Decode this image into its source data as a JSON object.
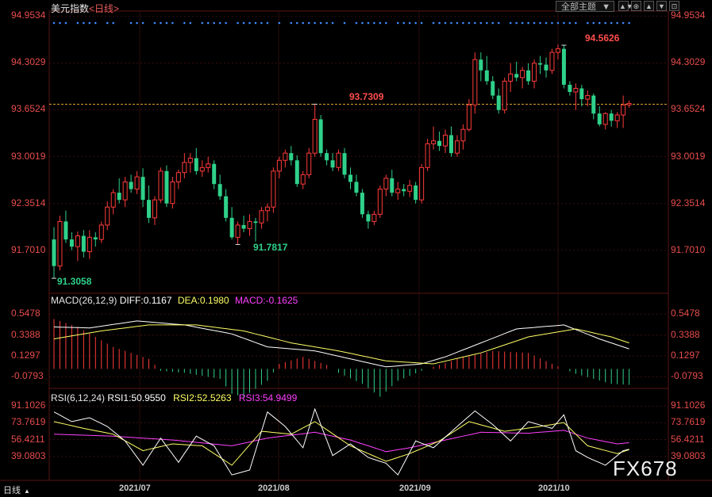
{
  "header": {
    "title": "美元指数",
    "period_tag": "<日线>",
    "theme_label": "全部主题",
    "theme_arrow": "▼",
    "tool_icons": [
      "▲▼",
      "⊕",
      "▲",
      "▼",
      "⊡"
    ]
  },
  "colors": {
    "up": "#ff3b3b",
    "down": "#2fd18a",
    "axis_text": "#e84c4c",
    "grid": "#3a0e0e",
    "ref_line": "#d9a030",
    "diff": "#ffffff",
    "dea": "#ffff66",
    "macd_label": "#ff40ff",
    "rsi3": "#ff40ff",
    "dots": "#3d8bfd"
  },
  "footer": {
    "period_label": "日线",
    "watermark": "FX678"
  },
  "chart_data": [
    {
      "type": "candlestick",
      "title": "美元指数<日线>",
      "ylim": [
        91.3,
        94.98
      ],
      "y_ticks": [
        "94.9534",
        "94.3029",
        "93.6524",
        "93.0019",
        "92.3514",
        "91.7010"
      ],
      "x_ticks": [
        "2021/07",
        "2021/08",
        "2021/09",
        "2021/10"
      ],
      "reference_line": 93.73,
      "annotations": [
        {
          "text": "94.5626",
          "type": "high",
          "index": 86
        },
        {
          "text": "93.7309",
          "type": "high",
          "index": 44
        },
        {
          "text": "91.7817",
          "type": "low",
          "index": 31
        },
        {
          "text": "91.3058",
          "type": "low",
          "index": 0
        }
      ],
      "marker_dots": "daily event markers row above the price series",
      "candles": [
        {
          "o": 91.85,
          "h": 92.02,
          "l": 91.31,
          "c": 91.48
        },
        {
          "o": 91.48,
          "h": 92.18,
          "l": 91.42,
          "c": 92.1
        },
        {
          "o": 92.1,
          "h": 92.25,
          "l": 91.8,
          "c": 91.85
        },
        {
          "o": 91.85,
          "h": 91.95,
          "l": 91.7,
          "c": 91.75
        },
        {
          "o": 91.75,
          "h": 91.96,
          "l": 91.55,
          "c": 91.9
        },
        {
          "o": 91.9,
          "h": 91.98,
          "l": 91.6,
          "c": 91.68
        },
        {
          "o": 91.68,
          "h": 91.98,
          "l": 91.58,
          "c": 91.88
        },
        {
          "o": 91.88,
          "h": 91.95,
          "l": 91.75,
          "c": 91.85
        },
        {
          "o": 91.85,
          "h": 92.1,
          "l": 91.8,
          "c": 92.05
        },
        {
          "o": 92.05,
          "h": 92.38,
          "l": 91.98,
          "c": 92.3
        },
        {
          "o": 92.3,
          "h": 92.55,
          "l": 92.2,
          "c": 92.5
        },
        {
          "o": 92.5,
          "h": 92.7,
          "l": 92.35,
          "c": 92.4
        },
        {
          "o": 92.4,
          "h": 92.72,
          "l": 92.3,
          "c": 92.65
        },
        {
          "o": 92.65,
          "h": 92.75,
          "l": 92.5,
          "c": 92.55
        },
        {
          "o": 92.55,
          "h": 92.8,
          "l": 92.48,
          "c": 92.72
        },
        {
          "o": 92.72,
          "h": 92.84,
          "l": 92.3,
          "c": 92.4
        },
        {
          "o": 92.4,
          "h": 92.6,
          "l": 92.08,
          "c": 92.15
        },
        {
          "o": 92.15,
          "h": 92.45,
          "l": 92.05,
          "c": 92.4
        },
        {
          "o": 92.4,
          "h": 92.85,
          "l": 92.36,
          "c": 92.8
        },
        {
          "o": 92.8,
          "h": 92.88,
          "l": 92.3,
          "c": 92.35
        },
        {
          "o": 92.35,
          "h": 92.72,
          "l": 92.28,
          "c": 92.65
        },
        {
          "o": 92.65,
          "h": 92.82,
          "l": 92.55,
          "c": 92.78
        },
        {
          "o": 92.78,
          "h": 93.05,
          "l": 92.7,
          "c": 92.92
        },
        {
          "o": 92.92,
          "h": 93.05,
          "l": 92.78,
          "c": 92.98
        },
        {
          "o": 92.98,
          "h": 93.12,
          "l": 92.75,
          "c": 92.8
        },
        {
          "o": 92.8,
          "h": 92.95,
          "l": 92.72,
          "c": 92.85
        },
        {
          "o": 92.85,
          "h": 93.0,
          "l": 92.78,
          "c": 92.9
        },
        {
          "o": 92.9,
          "h": 92.95,
          "l": 92.55,
          "c": 92.62
        },
        {
          "o": 92.62,
          "h": 92.75,
          "l": 92.4,
          "c": 92.45
        },
        {
          "o": 92.45,
          "h": 92.55,
          "l": 92.1,
          "c": 92.15
        },
        {
          "o": 92.15,
          "h": 92.3,
          "l": 91.85,
          "c": 91.88
        },
        {
          "o": 91.88,
          "h": 92.1,
          "l": 91.78,
          "c": 92.05
        },
        {
          "o": 92.05,
          "h": 92.18,
          "l": 91.95,
          "c": 92.0
        },
        {
          "o": 92.0,
          "h": 92.2,
          "l": 91.9,
          "c": 92.1
        },
        {
          "o": 92.1,
          "h": 92.15,
          "l": 91.82,
          "c": 92.08
        },
        {
          "o": 92.08,
          "h": 92.3,
          "l": 92.0,
          "c": 92.25
        },
        {
          "o": 92.25,
          "h": 92.35,
          "l": 92.1,
          "c": 92.3
        },
        {
          "o": 92.3,
          "h": 92.85,
          "l": 92.22,
          "c": 92.8
        },
        {
          "o": 92.8,
          "h": 93.0,
          "l": 92.7,
          "c": 92.95
        },
        {
          "o": 92.95,
          "h": 93.1,
          "l": 92.85,
          "c": 93.05
        },
        {
          "o": 93.05,
          "h": 93.15,
          "l": 92.88,
          "c": 92.95
        },
        {
          "o": 92.95,
          "h": 93.02,
          "l": 92.58,
          "c": 92.62
        },
        {
          "o": 92.62,
          "h": 92.8,
          "l": 92.55,
          "c": 92.75
        },
        {
          "o": 92.75,
          "h": 93.12,
          "l": 92.7,
          "c": 93.05
        },
        {
          "o": 93.05,
          "h": 93.73,
          "l": 93.0,
          "c": 93.52
        },
        {
          "o": 93.52,
          "h": 93.58,
          "l": 93.0,
          "c": 93.05
        },
        {
          "o": 93.05,
          "h": 93.1,
          "l": 92.88,
          "c": 92.95
        },
        {
          "o": 92.95,
          "h": 93.05,
          "l": 92.8,
          "c": 92.85
        },
        {
          "o": 92.85,
          "h": 93.1,
          "l": 92.8,
          "c": 93.05
        },
        {
          "o": 93.05,
          "h": 93.12,
          "l": 92.7,
          "c": 92.75
        },
        {
          "o": 92.75,
          "h": 92.85,
          "l": 92.55,
          "c": 92.65
        },
        {
          "o": 92.65,
          "h": 92.75,
          "l": 92.45,
          "c": 92.5
        },
        {
          "o": 92.5,
          "h": 92.55,
          "l": 92.15,
          "c": 92.2
        },
        {
          "o": 92.2,
          "h": 92.25,
          "l": 92.0,
          "c": 92.1
        },
        {
          "o": 92.1,
          "h": 92.25,
          "l": 92.05,
          "c": 92.2
        },
        {
          "o": 92.2,
          "h": 92.6,
          "l": 92.15,
          "c": 92.55
        },
        {
          "o": 92.55,
          "h": 92.75,
          "l": 92.45,
          "c": 92.7
        },
        {
          "o": 92.7,
          "h": 92.82,
          "l": 92.45,
          "c": 92.5
        },
        {
          "o": 92.5,
          "h": 92.65,
          "l": 92.4,
          "c": 92.55
        },
        {
          "o": 92.55,
          "h": 92.62,
          "l": 92.45,
          "c": 92.52
        },
        {
          "o": 92.52,
          "h": 92.68,
          "l": 92.44,
          "c": 92.6
        },
        {
          "o": 92.6,
          "h": 92.65,
          "l": 92.35,
          "c": 92.4
        },
        {
          "o": 92.4,
          "h": 92.9,
          "l": 92.35,
          "c": 92.85
        },
        {
          "o": 92.85,
          "h": 93.25,
          "l": 92.8,
          "c": 93.18
        },
        {
          "o": 93.18,
          "h": 93.42,
          "l": 93.1,
          "c": 93.22
        },
        {
          "o": 93.22,
          "h": 93.35,
          "l": 93.08,
          "c": 93.15
        },
        {
          "o": 93.15,
          "h": 93.38,
          "l": 93.05,
          "c": 93.3
        },
        {
          "o": 93.3,
          "h": 93.42,
          "l": 93.0,
          "c": 93.05
        },
        {
          "o": 93.05,
          "h": 93.3,
          "l": 93.0,
          "c": 93.22
        },
        {
          "o": 93.22,
          "h": 93.45,
          "l": 93.1,
          "c": 93.38
        },
        {
          "o": 93.38,
          "h": 93.8,
          "l": 93.35,
          "c": 93.72
        },
        {
          "o": 93.72,
          "h": 94.45,
          "l": 93.6,
          "c": 94.35
        },
        {
          "o": 94.35,
          "h": 94.45,
          "l": 94.05,
          "c": 94.2
        },
        {
          "o": 94.2,
          "h": 94.4,
          "l": 94.0,
          "c": 94.05
        },
        {
          "o": 94.05,
          "h": 94.12,
          "l": 93.8,
          "c": 93.85
        },
        {
          "o": 93.85,
          "h": 93.95,
          "l": 93.6,
          "c": 93.65
        },
        {
          "o": 93.65,
          "h": 94.1,
          "l": 93.6,
          "c": 94.05
        },
        {
          "o": 94.05,
          "h": 94.3,
          "l": 93.9,
          "c": 94.15
        },
        {
          "o": 94.15,
          "h": 94.32,
          "l": 94.05,
          "c": 94.1
        },
        {
          "o": 94.1,
          "h": 94.25,
          "l": 93.95,
          "c": 94.2
        },
        {
          "o": 94.2,
          "h": 94.3,
          "l": 94.0,
          "c": 94.05
        },
        {
          "o": 94.05,
          "h": 94.35,
          "l": 93.95,
          "c": 94.3
        },
        {
          "o": 94.3,
          "h": 94.4,
          "l": 94.15,
          "c": 94.28
        },
        {
          "o": 94.28,
          "h": 94.38,
          "l": 94.1,
          "c": 94.2
        },
        {
          "o": 94.2,
          "h": 94.5,
          "l": 94.15,
          "c": 94.45
        },
        {
          "o": 94.45,
          "h": 94.56,
          "l": 94.35,
          "c": 94.5
        },
        {
          "o": 94.5,
          "h": 94.55,
          "l": 93.95,
          "c": 94.0
        },
        {
          "o": 94.0,
          "h": 94.05,
          "l": 93.85,
          "c": 93.9
        },
        {
          "o": 93.9,
          "h": 94.02,
          "l": 93.65,
          "c": 93.95
        },
        {
          "o": 93.95,
          "h": 94.0,
          "l": 93.7,
          "c": 93.8
        },
        {
          "o": 93.8,
          "h": 93.92,
          "l": 93.7,
          "c": 93.85
        },
        {
          "o": 93.85,
          "h": 93.88,
          "l": 93.52,
          "c": 93.6
        },
        {
          "o": 93.6,
          "h": 93.7,
          "l": 93.42,
          "c": 93.45
        },
        {
          "o": 93.45,
          "h": 93.62,
          "l": 93.38,
          "c": 93.6
        },
        {
          "o": 93.6,
          "h": 93.65,
          "l": 93.42,
          "c": 93.5
        },
        {
          "o": 93.5,
          "h": 93.62,
          "l": 93.4,
          "c": 93.58
        },
        {
          "o": 93.58,
          "h": 93.85,
          "l": 93.4,
          "c": 93.72
        },
        {
          "o": 93.72,
          "h": 93.78,
          "l": 93.68,
          "c": 93.74
        }
      ]
    },
    {
      "type": "bar+line",
      "title": "MACD(26,12,9)",
      "legend": [
        {
          "label": "DIFF:0.1167",
          "color": "#ffffff"
        },
        {
          "label": "DEA:0.1980",
          "color": "#ffff66"
        },
        {
          "label": "MACD:-0.1625",
          "color": "#ff40ff"
        }
      ],
      "ylim": [
        -0.18,
        0.63
      ],
      "y_ticks": [
        "0.5478",
        "0.3388",
        "0.1297",
        "-0.0793"
      ],
      "diff_keypoints": [
        [
          0,
          0.42
        ],
        [
          6,
          0.41
        ],
        [
          14,
          0.48
        ],
        [
          22,
          0.44
        ],
        [
          30,
          0.35
        ],
        [
          36,
          0.22
        ],
        [
          44,
          0.18
        ],
        [
          50,
          0.1
        ],
        [
          56,
          0.02
        ],
        [
          62,
          0.05
        ],
        [
          66,
          0.12
        ],
        [
          72,
          0.26
        ],
        [
          78,
          0.4
        ],
        [
          86,
          0.44
        ],
        [
          92,
          0.3
        ],
        [
          100,
          0.14
        ]
      ],
      "dea_keypoints": [
        [
          0,
          0.3
        ],
        [
          8,
          0.38
        ],
        [
          16,
          0.44
        ],
        [
          24,
          0.44
        ],
        [
          32,
          0.38
        ],
        [
          40,
          0.26
        ],
        [
          48,
          0.18
        ],
        [
          56,
          0.08
        ],
        [
          64,
          0.05
        ],
        [
          72,
          0.16
        ],
        [
          80,
          0.32
        ],
        [
          88,
          0.4
        ],
        [
          94,
          0.32
        ],
        [
          100,
          0.2
        ]
      ],
      "hist_keypoints": [
        [
          0,
          0.5
        ],
        [
          4,
          0.42
        ],
        [
          10,
          0.22
        ],
        [
          16,
          0.1
        ],
        [
          18,
          -0.02
        ],
        [
          22,
          -0.04
        ],
        [
          28,
          -0.1
        ],
        [
          30,
          -0.25
        ],
        [
          32,
          -0.28
        ],
        [
          36,
          -0.12
        ],
        [
          38,
          0.05
        ],
        [
          42,
          0.12
        ],
        [
          46,
          0.04
        ],
        [
          48,
          -0.04
        ],
        [
          52,
          -0.15
        ],
        [
          55,
          -0.28
        ],
        [
          58,
          -0.12
        ],
        [
          62,
          -0.02
        ],
        [
          68,
          0.1
        ],
        [
          74,
          0.18
        ],
        [
          80,
          0.16
        ],
        [
          84,
          0.05
        ],
        [
          88,
          -0.05
        ],
        [
          94,
          -0.15
        ],
        [
          100,
          -0.17
        ]
      ]
    },
    {
      "type": "line",
      "title": "RSI(6,12,24)",
      "legend": [
        {
          "label": "RSI1:50.9550",
          "color": "#ffffff"
        },
        {
          "label": "RSI2:52.5263",
          "color": "#ffff66"
        },
        {
          "label": "RSI3:54.9499",
          "color": "#ff40ff"
        }
      ],
      "ylim": [
        16,
        97
      ],
      "y_ticks": [
        "91.1026",
        "73.7619",
        "56.4211",
        "39.0803"
      ],
      "rsi1_keypoints": [
        [
          0,
          85
        ],
        [
          3,
          75
        ],
        [
          6,
          79
        ],
        [
          9,
          70
        ],
        [
          12,
          55
        ],
        [
          15,
          30
        ],
        [
          18,
          58
        ],
        [
          21,
          33
        ],
        [
          24,
          60
        ],
        [
          27,
          50
        ],
        [
          30,
          20
        ],
        [
          33,
          25
        ],
        [
          36,
          85
        ],
        [
          39,
          70
        ],
        [
          42,
          48
        ],
        [
          44,
          88
        ],
        [
          47,
          40
        ],
        [
          50,
          52
        ],
        [
          53,
          38
        ],
        [
          56,
          32
        ],
        [
          58,
          20
        ],
        [
          61,
          55
        ],
        [
          64,
          48
        ],
        [
          68,
          70
        ],
        [
          71,
          86
        ],
        [
          74,
          72
        ],
        [
          77,
          55
        ],
        [
          80,
          75
        ],
        [
          84,
          68
        ],
        [
          86,
          82
        ],
        [
          88,
          45
        ],
        [
          90,
          38
        ],
        [
          93,
          30
        ],
        [
          96,
          45
        ],
        [
          100,
          51
        ]
      ],
      "rsi2_keypoints": [
        [
          0,
          75
        ],
        [
          5,
          68
        ],
        [
          10,
          62
        ],
        [
          15,
          45
        ],
        [
          20,
          52
        ],
        [
          25,
          50
        ],
        [
          30,
          30
        ],
        [
          35,
          65
        ],
        [
          40,
          62
        ],
        [
          44,
          75
        ],
        [
          50,
          50
        ],
        [
          56,
          34
        ],
        [
          60,
          42
        ],
        [
          65,
          55
        ],
        [
          70,
          75
        ],
        [
          76,
          65
        ],
        [
          82,
          70
        ],
        [
          86,
          74
        ],
        [
          90,
          50
        ],
        [
          95,
          42
        ],
        [
          100,
          52
        ]
      ],
      "rsi3_keypoints": [
        [
          0,
          62
        ],
        [
          10,
          60
        ],
        [
          20,
          56
        ],
        [
          30,
          50
        ],
        [
          36,
          58
        ],
        [
          44,
          64
        ],
        [
          50,
          56
        ],
        [
          56,
          44
        ],
        [
          60,
          48
        ],
        [
          66,
          56
        ],
        [
          72,
          64
        ],
        [
          80,
          63
        ],
        [
          86,
          66
        ],
        [
          90,
          58
        ],
        [
          95,
          52
        ],
        [
          100,
          55
        ]
      ]
    }
  ]
}
